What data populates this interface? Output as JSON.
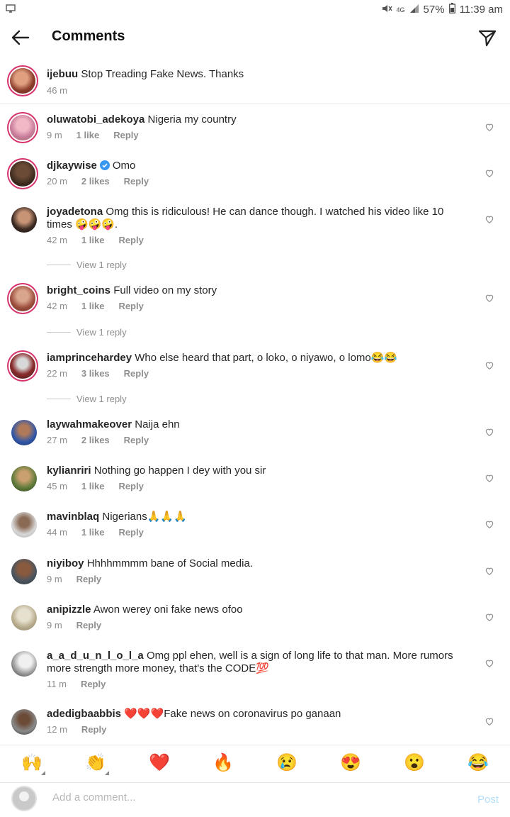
{
  "status": {
    "battery": "57%",
    "time": "11:39 am",
    "network": "4G"
  },
  "header": {
    "title": "Comments"
  },
  "caption": {
    "user": "ijebuu",
    "text": "Stop Treading Fake News. Thanks",
    "time": "46 m"
  },
  "comments": [
    {
      "user": "oluwatobi_adekoya",
      "text": "Nigeria my country",
      "time": "9 m",
      "likes": "1 like",
      "reply": "Reply"
    },
    {
      "user": "djkaywise",
      "verified": true,
      "text": "Omo",
      "time": "20 m",
      "likes": "2 likes",
      "reply": "Reply"
    },
    {
      "user": "joyadetona",
      "text": "Omg this is ridiculous! He can dance though. I watched his video like 10 times 🤪🤪🤪.",
      "time": "42 m",
      "likes": "1 like",
      "reply": "Reply",
      "view_replies": "View 1 reply"
    },
    {
      "user": "bright_coins",
      "text": "Full video on my story",
      "time": "42 m",
      "likes": "1 like",
      "reply": "Reply",
      "view_replies": "View 1 reply"
    },
    {
      "user": "iamprincehardey",
      "text": "Who else heard that part, o loko, o niyawo, o lomo😂😂",
      "time": "22 m",
      "likes": "3 likes",
      "reply": "Reply",
      "view_replies": "View 1 reply"
    },
    {
      "user": "laywahmakeover",
      "text": "Naija ehn",
      "time": "27 m",
      "likes": "2 likes",
      "reply": "Reply"
    },
    {
      "user": "kylianriri",
      "text": "Nothing go happen I dey with you sir",
      "time": "45 m",
      "likes": "1 like",
      "reply": "Reply"
    },
    {
      "user": "mavinblaq",
      "text": "Nigerians🙏🙏🙏",
      "time": "44 m",
      "likes": "1 like",
      "reply": "Reply"
    },
    {
      "user": "niyiboy",
      "text": "Hhhhmmmm bane of Social media.",
      "time": "9 m",
      "reply": "Reply"
    },
    {
      "user": "anipizzle",
      "text": "Awon werey oni fake news ofoo",
      "time": "9 m",
      "reply": "Reply"
    },
    {
      "user": "a_a_d_u_n_l_o_l_a",
      "text": "Omg ppl ehen, well is a sign of long life to that man. More rumors more strength more money, that's the CODE💯",
      "time": "11 m",
      "reply": "Reply"
    },
    {
      "user": "adedigbaabbis",
      "text": "❤️❤️❤️Fake news on coronavirus po ganaan",
      "time": "12 m",
      "reply": "Reply"
    }
  ],
  "emoji_bar": [
    "🙌",
    "👏",
    "❤️",
    "🔥",
    "😢",
    "😍",
    "😮",
    "😂"
  ],
  "composer": {
    "placeholder": "Add a comment...",
    "post_label": "Post"
  },
  "colors": {
    "accent": "#3897f0",
    "ring": "#d6336c",
    "post_disabled": "#b3dffc",
    "verified": "#3897f0"
  }
}
